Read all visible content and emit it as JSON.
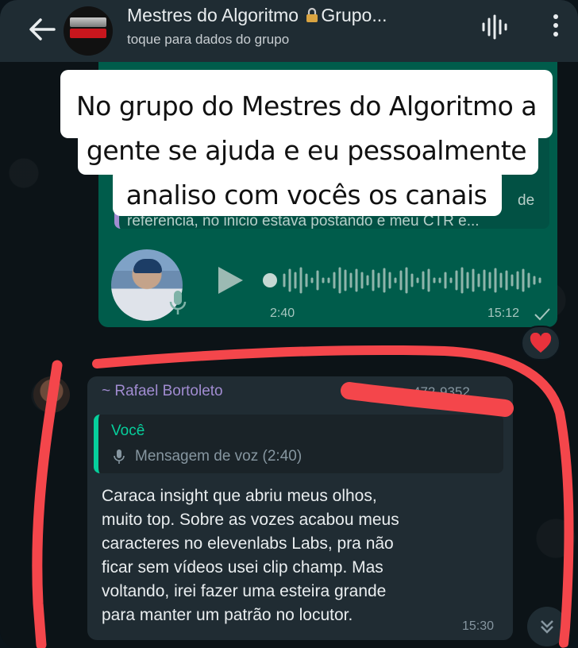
{
  "header": {
    "group_name_before_icon": "Mestres do Algoritmo ",
    "group_name_after_icon": "Grupo...",
    "subtitle": "toque para dados do grupo",
    "back_icon": "arrow-left-icon",
    "lock_icon": "lock-icon",
    "call_icon": "audio-waves-icon",
    "menu_icon": "more-vertical-icon"
  },
  "caption": {
    "text": "No grupo do Mestres do Algoritmo a gente se ajuda e eu pessoalmente analiso com vocês os canais"
  },
  "outgoing": {
    "quoted_snippet": "referencia, no inicio estava postando e meu CTR e...",
    "quoted_tail": "de",
    "audio_duration": "2:40",
    "time": "15:12",
    "reaction": "❤️"
  },
  "incoming": {
    "sender_name": "~ Rafael Bortoleto",
    "sender_phone": "472-9352",
    "reply_author": "Você",
    "reply_text": "Mensagem de voz (2:40)",
    "message": "Caraca insight que abriu meus olhos,\nmuito top. Sobre as vozes acabou meus\ncaracteres no elevenlabs Labs, pra não\nficar sem vídeos usei clip champ. Mas\nvoltando, irei fazer uma esteira grande\npara manter um patrão no locutor.",
    "time": "15:30"
  },
  "colors": {
    "header_bg": "#1f2c33",
    "outgoing_bubble": "#005c4b",
    "incoming_bubble": "#202c33",
    "sender_name": "#a18cd1",
    "reply_accent": "#06cf9c",
    "annotation_red": "#f4464b"
  }
}
